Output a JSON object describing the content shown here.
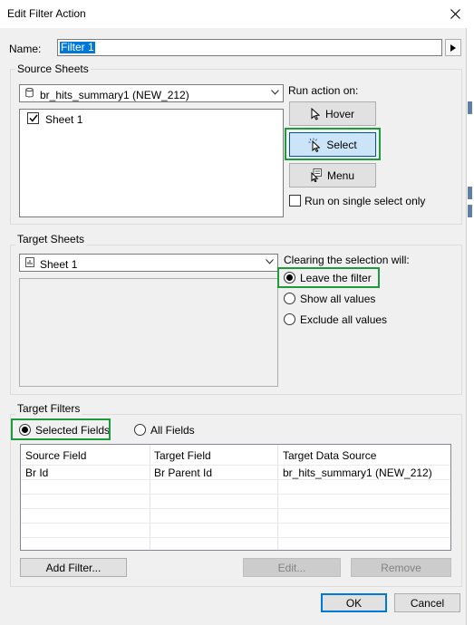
{
  "dialog": {
    "title": "Edit Filter Action",
    "name_label": "Name:",
    "name_value": "Filter 1"
  },
  "source_sheets": {
    "group_title": "Source Sheets",
    "data_source": "br_hits_summary1 (NEW_212)",
    "sheets": [
      {
        "label": "Sheet 1",
        "checked": true
      }
    ],
    "run_action_label": "Run action on:",
    "hover_label": "Hover",
    "select_label": "Select",
    "menu_label": "Menu",
    "single_select_label": "Run on single select only",
    "single_select_checked": false,
    "active_trigger": "Select"
  },
  "target_sheets": {
    "group_title": "Target Sheets",
    "selected_sheet": "Sheet 1",
    "clearing_label": "Clearing the selection will:",
    "options": [
      "Leave the filter",
      "Show all values",
      "Exclude all values"
    ],
    "selected_option": "Leave the filter"
  },
  "target_filters": {
    "group_title": "Target Filters",
    "selected_fields_label": "Selected Fields",
    "all_fields_label": "All Fields",
    "selected_mode": "Selected Fields",
    "columns": [
      "Source Field",
      "Target Field",
      "Target Data Source"
    ],
    "rows": [
      [
        "Br Id",
        "Br Parent Id",
        "br_hits_summary1 (NEW_212)"
      ]
    ],
    "add_filter_label": "Add Filter...",
    "edit_label": "Edit...",
    "remove_label": "Remove"
  },
  "footer": {
    "ok_label": "OK",
    "cancel_label": "Cancel"
  },
  "colors": {
    "highlight_box": "#1f9a3a",
    "selection_blue": "#0078d7",
    "selected_button": "#cce4f7",
    "dialog_background": "#f0f0f0"
  }
}
